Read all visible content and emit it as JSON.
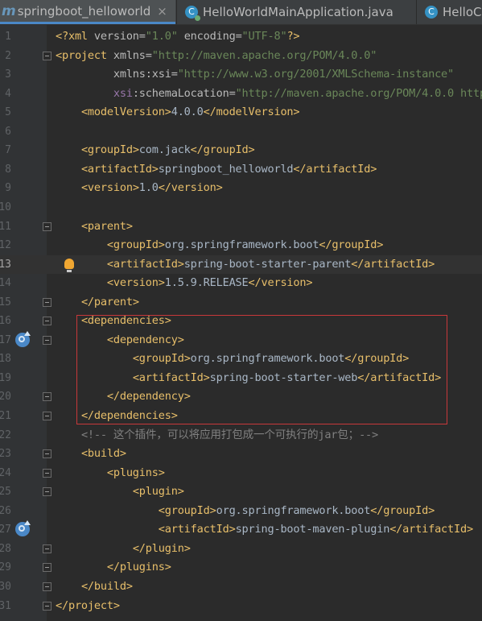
{
  "tabs": [
    {
      "label": "springboot_helloworld",
      "icon": "maven-m-icon",
      "active": true,
      "closable": true
    },
    {
      "label": "HelloWorldMainApplication.java",
      "icon": "java-class-run-icon",
      "active": false,
      "closable": false
    },
    {
      "label": "HelloC",
      "icon": "java-class-icon",
      "active": false,
      "closable": false
    }
  ],
  "tab_close_glyph": "×",
  "m_glyph": "m",
  "c_glyph": "C",
  "editor": {
    "current_line": 13,
    "line_numbers": [
      "1",
      "2",
      "3",
      "4",
      "5",
      "6",
      "7",
      "8",
      "9",
      "10",
      "11",
      "12",
      "13",
      "14",
      "15",
      "16",
      "17",
      "18",
      "19",
      "20",
      "21",
      "22",
      "23",
      "24",
      "25",
      "26",
      "27",
      "28",
      "29",
      "30",
      "31"
    ],
    "lines": [
      "<?xml version=\"1.0\" encoding=\"UTF-8\"?>",
      "<project xmlns=\"http://maven.apache.org/POM/4.0.0\"",
      "         xmlns:xsi=\"http://www.w3.org/2001/XMLSchema-instance\"",
      "         xsi:schemaLocation=\"http://maven.apache.org/POM/4.0.0 http",
      "    <modelVersion>4.0.0</modelVersion>",
      "",
      "    <groupId>com.jack</groupId>",
      "    <artifactId>springboot_helloworld</artifactId>",
      "    <version>1.0</version>",
      "",
      "    <parent>",
      "        <groupId>org.springframework.boot</groupId>",
      "        <artifactId>spring-boot-starter-parent</artifactId>",
      "        <version>1.5.9.RELEASE</version>",
      "    </parent>",
      "    <dependencies>",
      "        <dependency>",
      "            <groupId>org.springframework.boot</groupId>",
      "            <artifactId>spring-boot-starter-web</artifactId>",
      "        </dependency>",
      "    </dependencies>",
      "    <!-- 这个插件，可以将应用打包成一个可执行的jar包；-->",
      "    <build>",
      "        <plugins>",
      "            <plugin>",
      "                <groupId>org.springframework.boot</groupId>",
      "                <artifactId>spring-boot-maven-plugin</artifactId>",
      "            </plugin>",
      "        </plugins>",
      "    </build>",
      "</project>"
    ],
    "highlight_color": "#c8383a"
  }
}
